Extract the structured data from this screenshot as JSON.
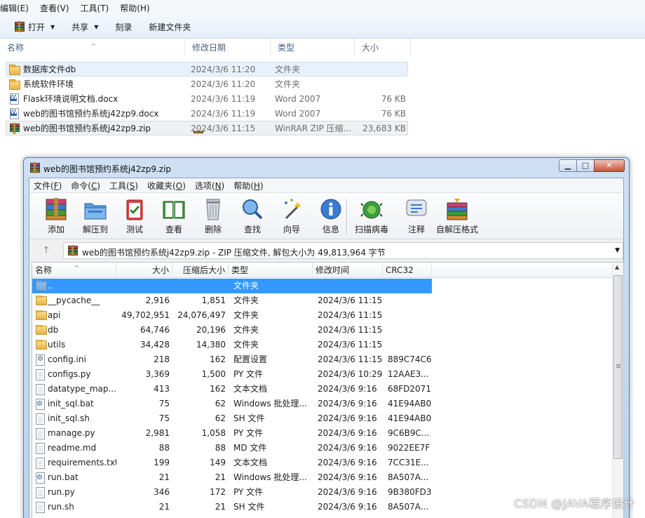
{
  "explorer": {
    "menu": [
      "编辑(E)",
      "查看(V)",
      "工具(T)",
      "帮助(H)"
    ],
    "toolbar": {
      "open": "打开",
      "share": "共享",
      "burn": "刻录",
      "new_folder": "新建文件夹"
    },
    "columns": {
      "name": "名称",
      "date": "修改日期",
      "type": "类型",
      "size": "大小"
    },
    "files": [
      {
        "icon": "folder-icon",
        "name": "数据库文件db",
        "date": "2024/3/6 11:20",
        "type": "文件夹",
        "size": ""
      },
      {
        "icon": "folder-icon",
        "name": "系统软件环境",
        "date": "2024/3/6 11:20",
        "type": "文件夹",
        "size": ""
      },
      {
        "icon": "word-doc-icon",
        "name": "Flask环境说明文档.docx",
        "date": "2024/3/6 11:19",
        "type": "Word 2007",
        "size": "76 KB"
      },
      {
        "icon": "word-doc-icon",
        "name": "web的图书馆预约系统j42zp9.docx",
        "date": "2024/3/6 11:19",
        "type": "Word 2007",
        "size": "76 KB"
      },
      {
        "icon": "winrar-archive-icon",
        "name": "web的图书馆预约系统j42zp9.zip",
        "date": "2024/3/6 11:15",
        "type": "WinRAR ZIP 压缩...",
        "size": "23,683 KB"
      }
    ]
  },
  "winrar": {
    "title": "web的图书馆预约系统j42zp9.zip",
    "menu": [
      {
        "label": "文件(",
        "key": "F",
        "end": ")"
      },
      {
        "label": "命令(",
        "key": "C",
        "end": ")"
      },
      {
        "label": "工具(",
        "key": "S",
        "end": ")"
      },
      {
        "label": "收藏夹(",
        "key": "O",
        "end": ")"
      },
      {
        "label": "选项(",
        "key": "N",
        "end": ")"
      },
      {
        "label": "帮助(",
        "key": "H",
        "end": ")"
      }
    ],
    "tools": [
      "添加",
      "解压到",
      "测试",
      "查看",
      "删除",
      "查找",
      "向导",
      "信息",
      "扫描病毒",
      "注释",
      "自解压格式"
    ],
    "address": "web的图书馆预约系统j42zp9.zip - ZIP 压缩文件, 解包大小为 49,813,964 字节",
    "columns": {
      "name": "名称",
      "size": "大小",
      "packed": "压缩后大小",
      "type": "类型",
      "modified": "修改时间",
      "crc": "CRC32"
    },
    "rows": [
      {
        "icon": "parent-folder-icon",
        "name": "..",
        "size": "",
        "packed": "",
        "type": "文件夹",
        "modified": "",
        "crc": ""
      },
      {
        "icon": "folder-icon",
        "name": "__pycache__",
        "size": "2,916",
        "packed": "1,851",
        "type": "文件夹",
        "modified": "2024/3/6 11:15",
        "crc": ""
      },
      {
        "icon": "folder-icon",
        "name": "api",
        "size": "49,702,951",
        "packed": "24,076,497",
        "type": "文件夹",
        "modified": "2024/3/6 11:15",
        "crc": ""
      },
      {
        "icon": "folder-icon",
        "name": "db",
        "size": "64,746",
        "packed": "20,196",
        "type": "文件夹",
        "modified": "2024/3/6 11:15",
        "crc": ""
      },
      {
        "icon": "folder-icon",
        "name": "utils",
        "size": "34,428",
        "packed": "14,380",
        "type": "文件夹",
        "modified": "2024/3/6 11:15",
        "crc": ""
      },
      {
        "icon": "config-file-icon",
        "name": "config.ini",
        "size": "218",
        "packed": "162",
        "type": "配置设置",
        "modified": "2024/3/6 11:15",
        "crc": "889C74C6"
      },
      {
        "icon": "file-icon",
        "name": "configs.py",
        "size": "3,369",
        "packed": "1,500",
        "type": "PY 文件",
        "modified": "2024/3/6 10:29",
        "crc": "12AAE3..."
      },
      {
        "icon": "file-icon",
        "name": "datatype_map....",
        "size": "413",
        "packed": "162",
        "type": "文本文档",
        "modified": "2024/3/6 9:16",
        "crc": "68FD2071"
      },
      {
        "icon": "batch-file-icon",
        "name": "init_sql.bat",
        "size": "75",
        "packed": "62",
        "type": "Windows 批处理...",
        "modified": "2024/3/6 9:16",
        "crc": "41E94AB0"
      },
      {
        "icon": "file-icon",
        "name": "init_sql.sh",
        "size": "75",
        "packed": "62",
        "type": "SH 文件",
        "modified": "2024/3/6 9:16",
        "crc": "41E94AB0"
      },
      {
        "icon": "file-icon",
        "name": "manage.py",
        "size": "2,981",
        "packed": "1,058",
        "type": "PY 文件",
        "modified": "2024/3/6 9:16",
        "crc": "9C6B9C..."
      },
      {
        "icon": "file-icon",
        "name": "readme.md",
        "size": "88",
        "packed": "88",
        "type": "MD 文件",
        "modified": "2024/3/6 9:16",
        "crc": "9022EE7F"
      },
      {
        "icon": "file-icon",
        "name": "requirements.txt",
        "size": "199",
        "packed": "149",
        "type": "文本文档",
        "modified": "2024/3/6 9:16",
        "crc": "7CC31E..."
      },
      {
        "icon": "batch-file-icon",
        "name": "run.bat",
        "size": "21",
        "packed": "21",
        "type": "Windows 批处理...",
        "modified": "2024/3/6 9:16",
        "crc": "8A507A..."
      },
      {
        "icon": "file-icon",
        "name": "run.py",
        "size": "346",
        "packed": "172",
        "type": "PY 文件",
        "modified": "2024/3/6 9:16",
        "crc": "9B380FD3"
      },
      {
        "icon": "file-icon",
        "name": "run.sh",
        "size": "21",
        "packed": "21",
        "type": "SH 文件",
        "modified": "2024/3/6 9:16",
        "crc": "8A507A..."
      }
    ]
  },
  "watermark": "CSDN @JAVA程序设计",
  "colors": {
    "selection": "#3399ff",
    "window_frame": "#bcd3ec"
  }
}
